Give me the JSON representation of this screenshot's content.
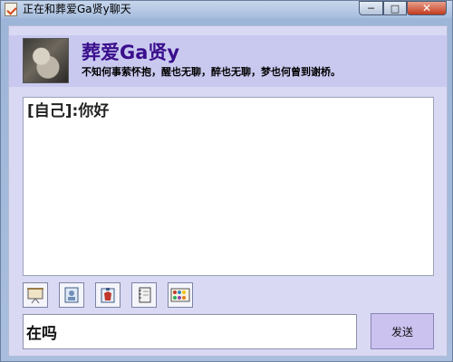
{
  "window": {
    "title": "正在和葬爱Ga贤y聊天",
    "controls": {
      "minimize": "─",
      "maximize": "□",
      "close": "✕"
    }
  },
  "contact": {
    "name": "葬爱Ga贤y",
    "signature": "不知何事萦怀抱，醒也无聊，醉也无聊，梦也何曾到谢桥。"
  },
  "chat": {
    "messages": [
      {
        "text": "[自己]:你好"
      }
    ]
  },
  "toolbar": {
    "icons": [
      "screen-icon",
      "contact-card-icon",
      "profile-icon",
      "notebook-icon",
      "palette-icon"
    ]
  },
  "compose": {
    "input_value": "在吗",
    "send_label": "发送"
  }
}
